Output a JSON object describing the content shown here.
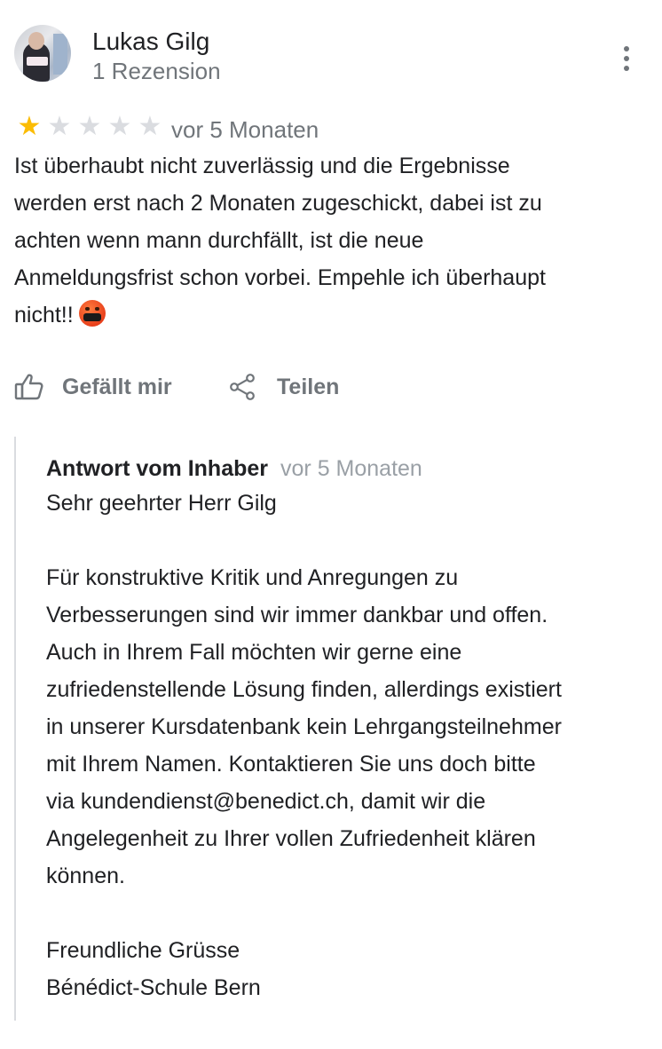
{
  "reviewer": {
    "name": "Lukas Gilg",
    "review_count": "1 Rezension"
  },
  "review": {
    "rating": 1,
    "max_rating": 5,
    "date": "vor 5 Monaten",
    "text": "Ist überhaubt nicht zuverlässig und die Ergebnisse\nwerden erst nach 2 Monaten zugeschickt, dabei ist zu\nachten wenn mann durchfällt, ist die neue\nAnmeldungsfrist schon vorbei. Empehle ich überhaupt\nnicht!!",
    "emoji": "face-with-symbols-over-mouth"
  },
  "actions": {
    "like_label": "Gefällt mir",
    "share_label": "Teilen"
  },
  "owner_response": {
    "label": "Antwort vom Inhaber",
    "date": "vor 5 Monaten",
    "text": "Sehr geehrter Herr Gilg\n\nFür konstruktive Kritik und Anregungen zu\nVerbesserungen sind wir immer dankbar und offen.\nAuch in Ihrem Fall möchten wir gerne eine\nzufriedenstellende Lösung finden, allerdings existiert\nin unserer Kursdatenbank kein Lehrgangsteilnehmer\nmit Ihrem Namen. Kontaktieren Sie uns doch bitte\nvia kundendienst@benedict.ch, damit wir die\nAngelegenheit zu Ihrer vollen Zufriedenheit klären\nkönnen.\n\nFreundliche Grüsse\nBénédict-Schule Bern"
  },
  "colors": {
    "star_filled": "#fbbc04",
    "star_empty": "#dadce0",
    "secondary_text": "#70757a",
    "primary_text": "#202124"
  },
  "icons": {
    "more": "more-vert-icon",
    "like": "thumb-up-icon",
    "share": "share-icon"
  }
}
